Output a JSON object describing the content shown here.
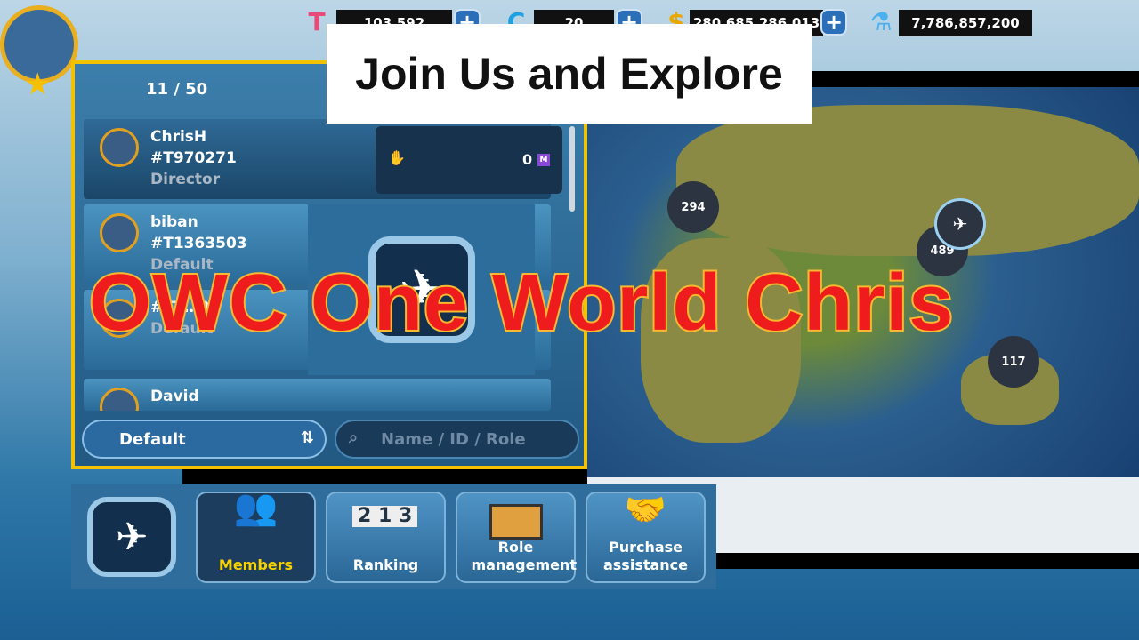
{
  "resources": {
    "tickets": "103,592",
    "coins": "20",
    "money": "280,685,286,013",
    "research": "7,786,857,200"
  },
  "banner": {
    "title": "Join Us and Explore",
    "overlay": "OWC One World Chris"
  },
  "panel": {
    "member_count": "11 / 50",
    "members": [
      {
        "name": "ChrisH",
        "id": "#T970271",
        "role": "Director",
        "value": "0"
      },
      {
        "name": "biban",
        "id": "#T1363503",
        "role": "Default",
        "value": ""
      },
      {
        "name": "",
        "id": "#T7…0",
        "role": "Default",
        "value": ""
      },
      {
        "name": "David",
        "id": "",
        "role": "",
        "value": ""
      }
    ],
    "sort_label": "Default",
    "search_placeholder": "Name / ID / Role"
  },
  "map": {
    "pins": [
      "294",
      "489",
      "117"
    ]
  },
  "nav": {
    "items": [
      "Members",
      "Ranking",
      "Role management",
      "Purchase assistance"
    ],
    "active": "Members",
    "ranking_digits": [
      "2",
      "1",
      "3"
    ]
  },
  "colors": {
    "panel_border": "#f2c200",
    "overlay_text": "#ee1c1c",
    "active_label": "#f7d200"
  }
}
